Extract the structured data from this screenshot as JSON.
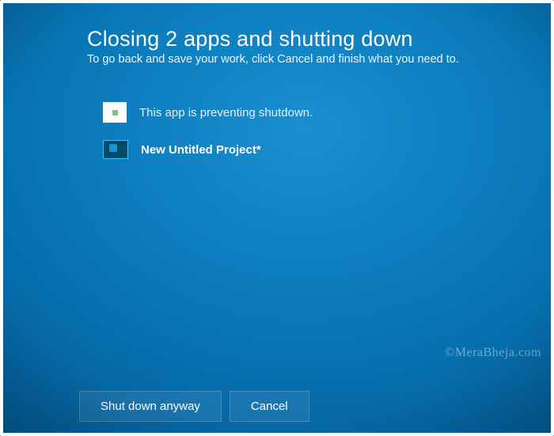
{
  "header": {
    "title": "Closing 2 apps and shutting down",
    "subtitle": "To go back and save your work, click Cancel and finish what you need to."
  },
  "apps": [
    {
      "icon": "blank-app-icon",
      "label": "This app is preventing shutdown.",
      "is_status": true
    },
    {
      "icon": "video-app-icon",
      "label": "New Untitled Project*",
      "is_status": false
    }
  ],
  "buttons": {
    "shutdown": "Shut down anyway",
    "cancel": "Cancel"
  },
  "watermark": "©MeraBheja.com"
}
